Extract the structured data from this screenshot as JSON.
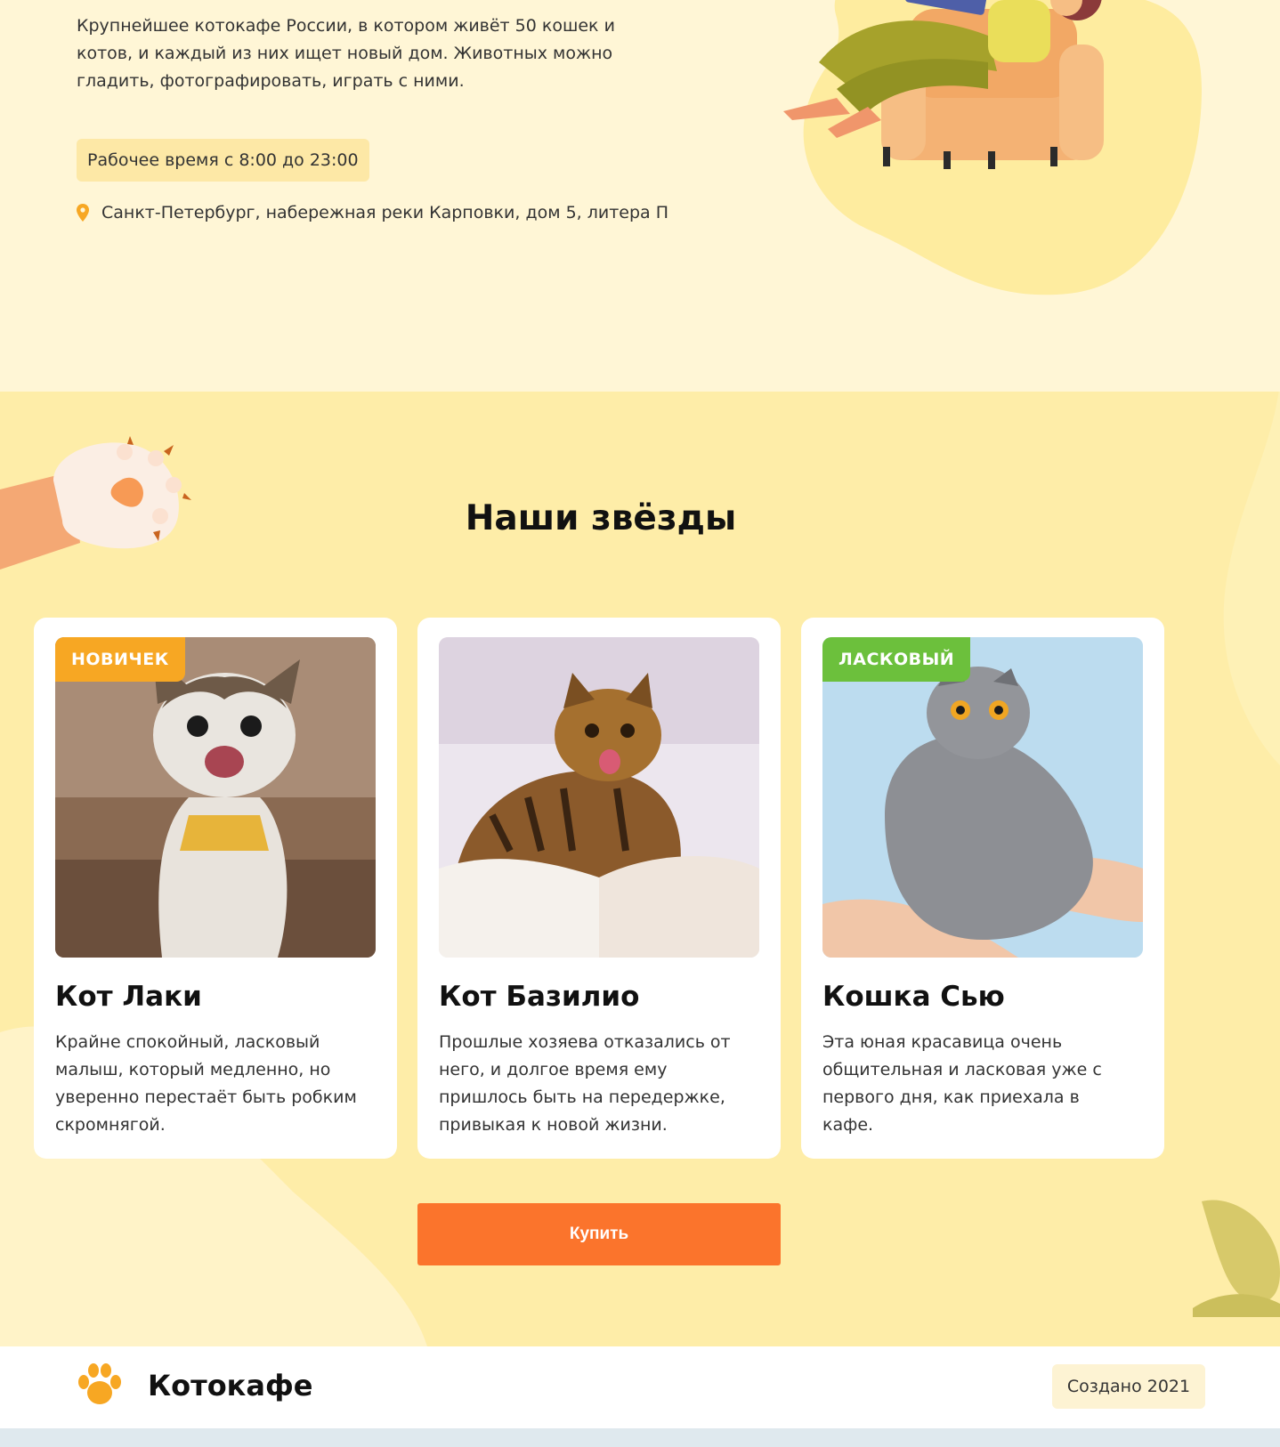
{
  "hero": {
    "description": "Крупнейшее котокафе России, в котором живёт 50 кошек и котов, и каждый из них ищет новый дом. Животных можно гладить, фотографировать, играть с ними.",
    "hours": "Рабочее время с 8:00 до 23:00",
    "address": "Санкт-Петербург, набережная реки Карповки, дом 5, литера П",
    "address_icon": "location-pin-icon"
  },
  "stars": {
    "title": "Наши звёзды",
    "cards": [
      {
        "badge": "НОВИЧЕК",
        "badge_color": "#f7a723",
        "name": "Кот Лаки",
        "description": "Крайне спокойный, ласковый малыш, который медленно, но уверенно перестаёт быть робким скромнягой."
      },
      {
        "badge": "",
        "badge_color": "",
        "name": "Кот Базилио",
        "description": "Прошлые хозяева отказались от него, и долгое время ему пришлось быть на передержке, привыкая к новой жизни."
      },
      {
        "badge": "ЛАСКОВЫЙ",
        "badge_color": "#6cc03c",
        "name": "Кошка Сью",
        "description": "Эта юная красавица очень общительная и ласковая уже с первого дня, как приехала в кафе."
      }
    ],
    "buy_label": "Купить"
  },
  "footer": {
    "brand": "Котокафе",
    "logo_icon": "paw-icon",
    "created": "Создано 2021"
  },
  "colors": {
    "accent": "#fb742c",
    "section_bg": "#feeda8",
    "hero_bg": "#fff6d6"
  }
}
